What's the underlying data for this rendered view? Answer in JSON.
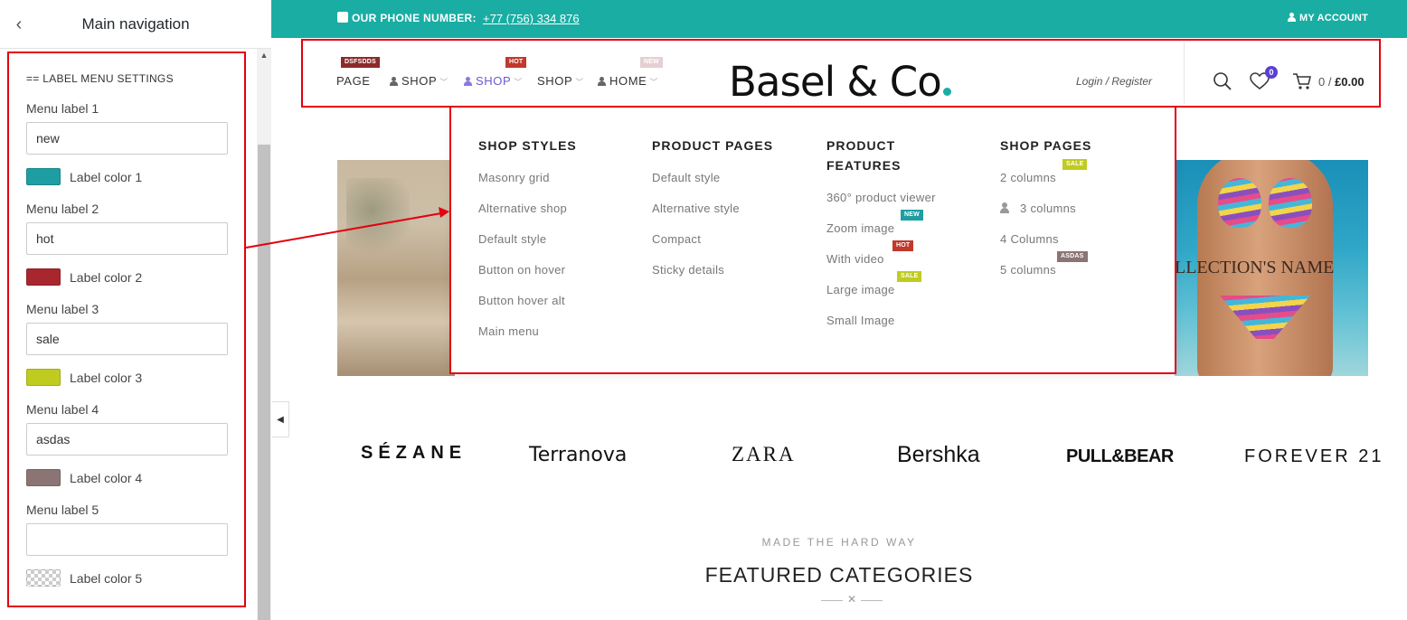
{
  "sidebar": {
    "back_symbol": "‹",
    "title": "Main navigation",
    "section_title": "== LABEL MENU SETTINGS",
    "fields": [
      {
        "label": "Menu label 1",
        "value": "new",
        "color_label": "Label color 1",
        "color": "#1e9ea3"
      },
      {
        "label": "Menu label 2",
        "value": "hot",
        "color_label": "Label color 2",
        "color": "#a8272e"
      },
      {
        "label": "Menu label 3",
        "value": "sale",
        "color_label": "Label color 3",
        "color": "#c0cb1f"
      },
      {
        "label": "Menu label 4",
        "value": "asdas",
        "color_label": "Label color 4",
        "color": "#8b7574"
      },
      {
        "label": "Menu label 5",
        "value": "",
        "color_label": "Label color 5",
        "color": "transparent"
      }
    ]
  },
  "topbar": {
    "phone_label": "OUR PHONE NUMBER:",
    "phone_number": "+77 (756) 334 876",
    "account": "MY ACCOUNT"
  },
  "nav": {
    "items": [
      {
        "label": "PAGE",
        "badge": "DSFSDDS",
        "badge_color": "#8b2a2a"
      },
      {
        "label": "SHOP",
        "badge": "",
        "badge_color": ""
      },
      {
        "label": "SHOP",
        "badge": "HOT",
        "badge_color": "#c0392b"
      },
      {
        "label": "SHOP",
        "badge": "",
        "badge_color": ""
      },
      {
        "label": "HOME",
        "badge": "NEW",
        "badge_color": "#e6cfd3"
      }
    ],
    "logo": "Basel & Co",
    "login": "Login / Register",
    "wishlist_count": "0",
    "cart": "0 / ",
    "cart_total": "£0.00"
  },
  "mega_menu": {
    "columns": [
      {
        "title": "SHOP STYLES",
        "links": [
          "Masonry grid",
          "Alternative shop",
          "Default style",
          "Button on hover",
          "Button hover alt",
          "Main menu"
        ]
      },
      {
        "title": "PRODUCT PAGES",
        "links": [
          "Default style",
          "Alternative style",
          "Compact",
          "Sticky details"
        ]
      },
      {
        "title_line1": "PRODUCT",
        "title_line2": "FEATURES",
        "links": [
          "360° product viewer",
          "Zoom image",
          "With video",
          "Large image",
          "Small Image"
        ]
      },
      {
        "title": "SHOP PAGES",
        "links": [
          "2 columns",
          "3 columns",
          "4 Columns",
          "5 columns"
        ]
      }
    ],
    "badges": {
      "zoom": {
        "text": "NEW",
        "color": "#1e9ea3"
      },
      "video": {
        "text": "HOT",
        "color": "#c0392b"
      },
      "large": {
        "text": "SALE",
        "color": "#c0cb1f"
      },
      "two_col": {
        "text": "SALE",
        "color": "#c0cb1f"
      },
      "five_col": {
        "text": "ASDAS",
        "color": "#8b7574"
      }
    }
  },
  "hero": {
    "caption": "LLECTION'S NAME"
  },
  "brands": [
    "SÉZANE",
    "Terranova",
    "ZARA",
    "Bershka",
    "PULL&BEAR",
    "FOREVER 21"
  ],
  "featured": {
    "kicker": "MADE THE HARD WAY",
    "title": "FEATURED CATEGORIES"
  }
}
